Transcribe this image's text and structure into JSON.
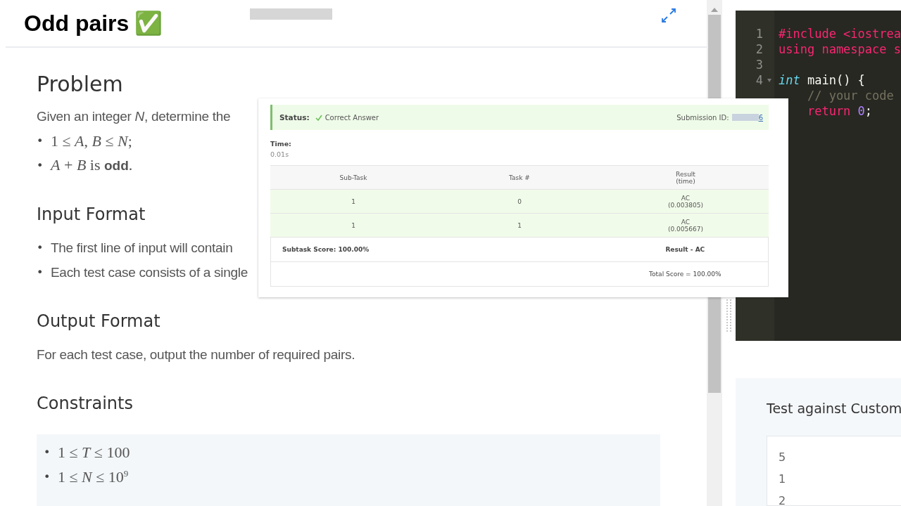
{
  "header": {
    "title": "Odd pairs",
    "title_emoji": "✅"
  },
  "sections": [
    {
      "heading": "Problem",
      "paragraphs": [
        "Given an integer *N*, determine the"
      ],
      "bullets": [
        {
          "kind": "math",
          "marker": "•",
          "text": "1 ≤ *A*, *B* ≤ *N*;"
        },
        {
          "kind": "mixed",
          "marker": "•",
          "text": "*A* + *B* is **odd**."
        }
      ]
    },
    {
      "heading": "Input Format",
      "bullets": [
        {
          "kind": "text",
          "marker": "•",
          "text": "The first line of input will contain"
        },
        {
          "kind": "text",
          "marker": "•",
          "text": "Each test case consists of a single"
        }
      ]
    },
    {
      "heading": "Output Format",
      "paragraphs": [
        "For each test case, output the number of required pairs."
      ]
    },
    {
      "heading": "Constraints",
      "boxed": true,
      "bullets": [
        {
          "kind": "math",
          "marker": "•",
          "text": "1 ≤ *T* ≤ 100"
        },
        {
          "kind": "math",
          "marker": "•",
          "text": "1 ≤ *N* ≤ 10$^{9}$"
        }
      ]
    }
  ],
  "editor": {
    "lines": [
      {
        "number": "1",
        "tokens": [
          {
            "kind": "keyword",
            "text": "#include <iostrea"
          }
        ]
      },
      {
        "number": "2",
        "tokens": [
          {
            "kind": "keyword",
            "text": "using namespace s"
          }
        ]
      },
      {
        "number": "3"
      },
      {
        "number": "4",
        "fold": true,
        "tokens": [
          {
            "kind": "type",
            "text": "int"
          },
          {
            "kind": "plain",
            "text": " main() {"
          }
        ]
      },
      {
        "tokens": [
          {
            "kind": "comment",
            "text": "    // your code"
          }
        ]
      },
      {
        "tokens": [
          {
            "kind": "keyword",
            "text": "    return "
          },
          {
            "kind": "number",
            "text": "0"
          },
          {
            "kind": "plain",
            "text": ";"
          }
        ]
      }
    ]
  },
  "custom_test": {
    "title": "Test against Custom",
    "input_lines": [
      "5",
      "1",
      "2"
    ]
  },
  "result": {
    "status_label": "Status:",
    "status": "Correct Answer",
    "submission_label": "Submission ID:",
    "submission_id_visible": "6",
    "time_label": "Time:",
    "time": "0.01s",
    "columns": [
      "Sub-Task",
      "Task #",
      "Result\n(time)"
    ],
    "rows": [
      {
        "passed": true,
        "cells": [
          "1",
          "0",
          "AC\n(0.003805)"
        ]
      },
      {
        "passed": true,
        "cells": [
          "1",
          "1",
          "AC\n(0.005667)"
        ]
      }
    ],
    "subtask_score": "Subtask Score: 100.00%",
    "subtask_result": "Result - AC",
    "total_score": "Total Score = 100.00%"
  }
}
